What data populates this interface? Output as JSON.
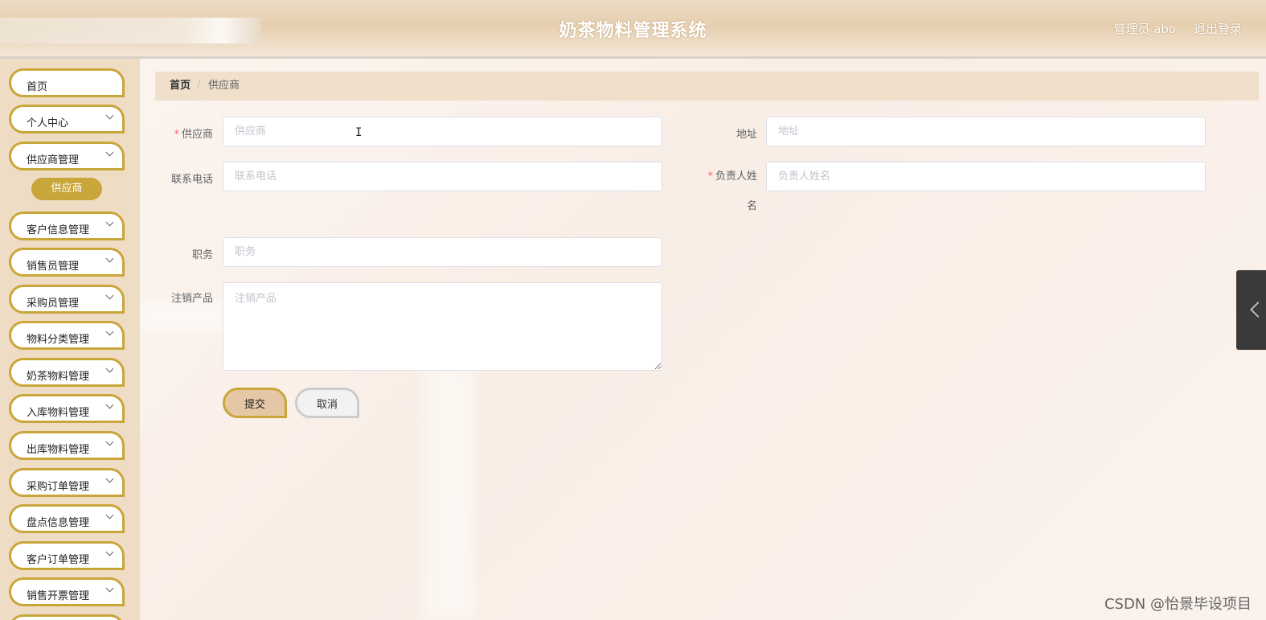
{
  "header": {
    "title": "奶茶物料管理系统",
    "user": "管理员 abo",
    "logout": "退出登录"
  },
  "sidebar": {
    "items": [
      {
        "label": "首页",
        "has_children": false
      },
      {
        "label": "个人中心",
        "has_children": true
      },
      {
        "label": "供应商管理",
        "has_children": true
      },
      {
        "label": "客户信息管理",
        "has_children": true
      },
      {
        "label": "销售员管理",
        "has_children": true
      },
      {
        "label": "采购员管理",
        "has_children": true
      },
      {
        "label": "物料分类管理",
        "has_children": true
      },
      {
        "label": "奶茶物料管理",
        "has_children": true
      },
      {
        "label": "入库物料管理",
        "has_children": true
      },
      {
        "label": "出库物料管理",
        "has_children": true
      },
      {
        "label": "采购订单管理",
        "has_children": true
      },
      {
        "label": "盘点信息管理",
        "has_children": true
      },
      {
        "label": "客户订单管理",
        "has_children": true
      },
      {
        "label": "销售开票管理",
        "has_children": true
      }
    ],
    "active_subitem": "供应商"
  },
  "breadcrumb": {
    "home": "首页",
    "separator": "/",
    "current": "供应商"
  },
  "form": {
    "supplier": {
      "label": "供应商",
      "required": "*",
      "placeholder": "供应商",
      "value": ""
    },
    "address": {
      "label": "地址",
      "placeholder": "地址",
      "value": ""
    },
    "phone": {
      "label": "联系电话",
      "placeholder": "联系电话",
      "value": ""
    },
    "contact_name": {
      "label_line1": "负责人姓",
      "label_line2": "名",
      "required": "*",
      "placeholder": "负责人姓名",
      "value": ""
    },
    "position": {
      "label": "职务",
      "placeholder": "职务",
      "value": ""
    },
    "products": {
      "label": "注销产品",
      "placeholder": "注销产品",
      "value": ""
    },
    "submit": "提交",
    "cancel": "取消"
  },
  "watermark": "CSDN @怡景毕设项目",
  "colors": {
    "accent": "#c9a63a",
    "sidebar_bg": "#efdcc4",
    "breadcrumb_bg": "#f0dfca",
    "submit_bg": "#e5c7a6"
  }
}
